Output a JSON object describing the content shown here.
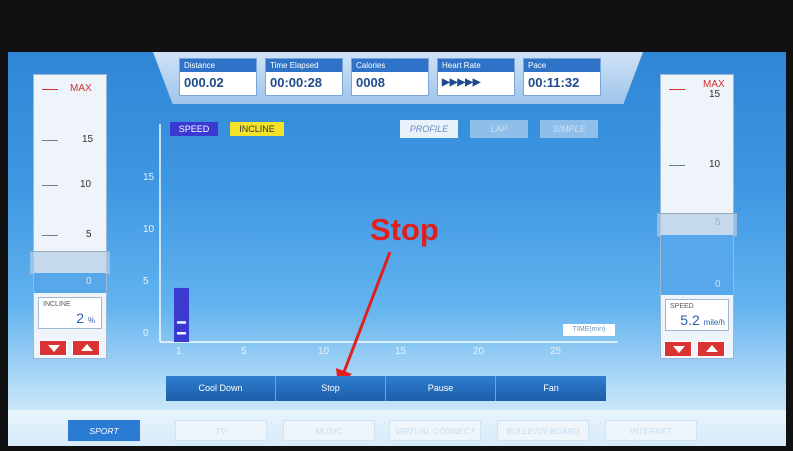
{
  "metrics": [
    {
      "label": "Distance",
      "value": "000.02"
    },
    {
      "label": "Time Elapsed",
      "value": "00:00:28"
    },
    {
      "label": "Calories",
      "value": "0008"
    },
    {
      "label": "Heart Rate",
      "value": "▶▶▶▶▶"
    },
    {
      "label": "Pace",
      "value": "00:11:32"
    }
  ],
  "incline_gauge": {
    "max": "MAX",
    "labels": [
      "15",
      "10",
      "5",
      "0"
    ],
    "readout_label": "INCLINE",
    "readout_value": "2",
    "readout_unit": "%"
  },
  "speed_gauge": {
    "max": "MAX",
    "labels": [
      "15",
      "10",
      "5",
      "0"
    ],
    "readout_label": "SPEED",
    "readout_value": "5.2",
    "readout_unit": "mile/h"
  },
  "chart": {
    "legend_speed": "SPEED",
    "legend_incline": "INCLINE",
    "modes": [
      "PROFILE",
      "LAP",
      "SIMPLE"
    ],
    "y_ticks": [
      "15",
      "10",
      "5",
      "0"
    ],
    "x_ticks": [
      "1",
      "5",
      "10",
      "15",
      "20",
      "25"
    ],
    "x_label": "TIME(min)"
  },
  "chart_data": {
    "type": "bar",
    "x": [
      1
    ],
    "series": [
      {
        "name": "SPEED",
        "values": [
          5.2
        ]
      },
      {
        "name": "INCLINE",
        "values": [
          2
        ]
      }
    ],
    "xlabel": "TIME(min)",
    "ylim": [
      0,
      15
    ],
    "xlim": [
      1,
      25
    ]
  },
  "controls": [
    "Cool Down",
    "Stop",
    "Pause",
    "Fan"
  ],
  "tabs": [
    "SPORT",
    "TV",
    "MUSIC",
    "VIRTUAL CONNECT",
    "BULLETIN BOARD",
    "INTERNET"
  ],
  "annotation": "Stop",
  "colors": {
    "speed": "#3a3ad0",
    "incline": "#f2e32a",
    "accent": "#d23030"
  }
}
